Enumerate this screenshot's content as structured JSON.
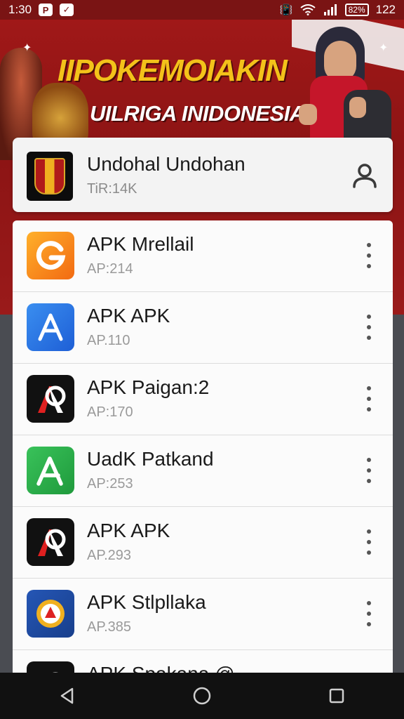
{
  "status_bar": {
    "time": "1:30",
    "badge_p": "P",
    "right_text": "122",
    "battery_label": "82%"
  },
  "banner": {
    "title": "IIPOKEMOIAKIN",
    "subtitle": "UILRIGA INIDONESIAI"
  },
  "header": {
    "title": "Undohal Undohan",
    "subtitle": "TiR:14K",
    "user_icon": "user-icon"
  },
  "apps": [
    {
      "name": "APK Mrellail",
      "sub": "AP:214",
      "icon": "orange-g-logo"
    },
    {
      "name": "APK APK",
      "sub": "AP.110",
      "icon": "blue-a-logo"
    },
    {
      "name": "APK Paigan:2",
      "sub": "AP:170",
      "icon": "black-red-a-logo"
    },
    {
      "name": "UadK Patkand",
      "sub": "AP:253",
      "icon": "green-a-logo"
    },
    {
      "name": "APK APK",
      "sub": "AP.293",
      "icon": "black-red-a-logo"
    },
    {
      "name": "APK Stlpllaka",
      "sub": "AP.385",
      "icon": "emblem-logo"
    },
    {
      "name": "APK Spakana @",
      "sub": "",
      "icon": "black-red-a-logo"
    }
  ],
  "colors": {
    "status_bar": "#7a1414",
    "banner": "#a01818",
    "title_yellow": "#f3c21a"
  },
  "nav": {
    "back": "back-icon",
    "home": "home-icon",
    "recents": "recents-icon"
  }
}
